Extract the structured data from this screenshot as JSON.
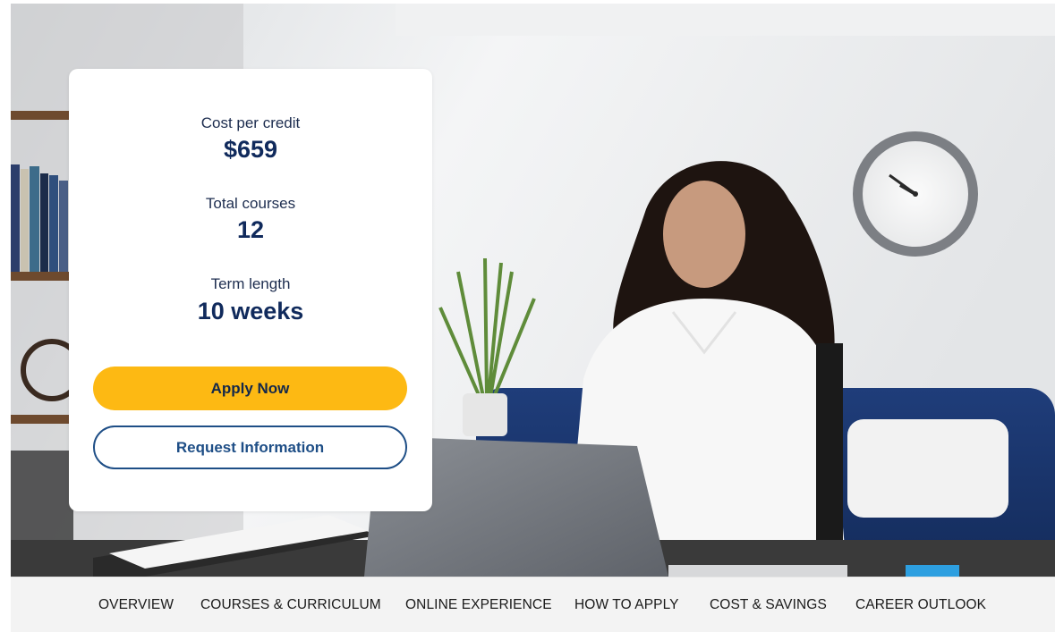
{
  "card": {
    "stats": [
      {
        "label": "Cost per credit",
        "value": "$659"
      },
      {
        "label": "Total courses",
        "value": "12"
      },
      {
        "label": "Term length",
        "value": "10 weeks"
      }
    ],
    "primary_button": "Apply Now",
    "secondary_button": "Request Information"
  },
  "section_nav": {
    "items": [
      "OVERVIEW",
      "COURSES & CURRICULUM",
      "ONLINE EXPERIENCE",
      "HOW TO APPLY",
      "COST & SAVINGS",
      "CAREER OUTLOOK"
    ]
  },
  "colors": {
    "primary_button_bg": "#fdb913",
    "secondary_button_border": "#1e4e86",
    "value_text": "#102a5c",
    "nav_bg": "#f3f3f3"
  },
  "icons": [
    "wall-clock-image",
    "laptop-image",
    "plant-image"
  ]
}
